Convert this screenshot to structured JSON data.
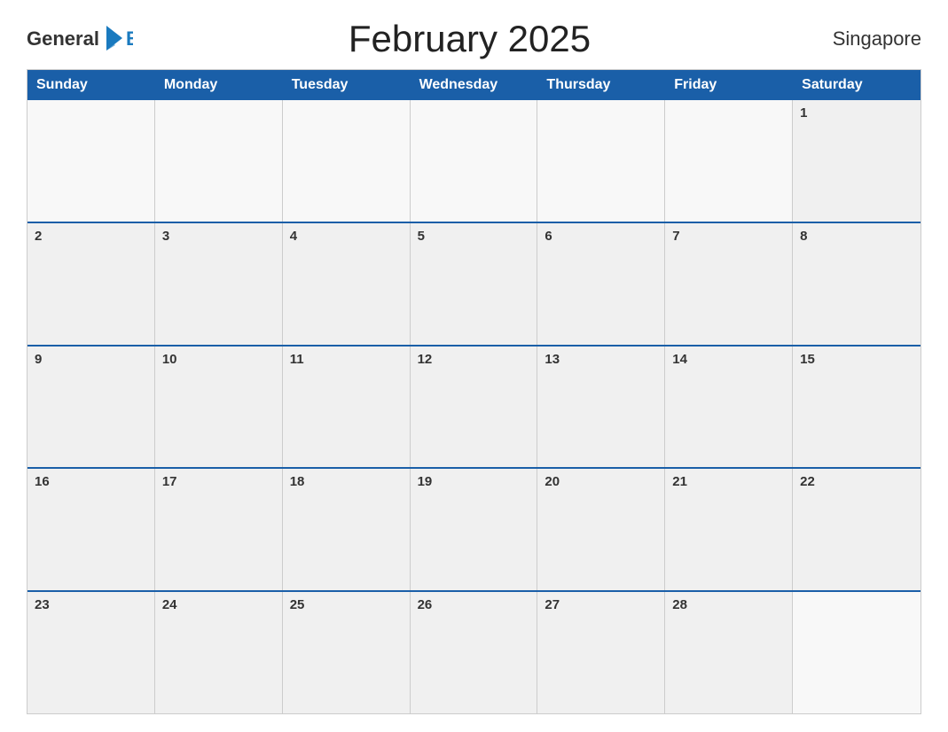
{
  "header": {
    "logo": {
      "text1": "General",
      "text2": "Blue"
    },
    "title": "February 2025",
    "region": "Singapore"
  },
  "days_of_week": [
    "Sunday",
    "Monday",
    "Tuesday",
    "Wednesday",
    "Thursday",
    "Friday",
    "Saturday"
  ],
  "weeks": [
    [
      {
        "day": "",
        "empty": true
      },
      {
        "day": "",
        "empty": true
      },
      {
        "day": "",
        "empty": true
      },
      {
        "day": "",
        "empty": true
      },
      {
        "day": "",
        "empty": true
      },
      {
        "day": "",
        "empty": true
      },
      {
        "day": "1",
        "empty": false
      }
    ],
    [
      {
        "day": "2",
        "empty": false
      },
      {
        "day": "3",
        "empty": false
      },
      {
        "day": "4",
        "empty": false
      },
      {
        "day": "5",
        "empty": false
      },
      {
        "day": "6",
        "empty": false
      },
      {
        "day": "7",
        "empty": false
      },
      {
        "day": "8",
        "empty": false
      }
    ],
    [
      {
        "day": "9",
        "empty": false
      },
      {
        "day": "10",
        "empty": false
      },
      {
        "day": "11",
        "empty": false
      },
      {
        "day": "12",
        "empty": false
      },
      {
        "day": "13",
        "empty": false
      },
      {
        "day": "14",
        "empty": false
      },
      {
        "day": "15",
        "empty": false
      }
    ],
    [
      {
        "day": "16",
        "empty": false
      },
      {
        "day": "17",
        "empty": false
      },
      {
        "day": "18",
        "empty": false
      },
      {
        "day": "19",
        "empty": false
      },
      {
        "day": "20",
        "empty": false
      },
      {
        "day": "21",
        "empty": false
      },
      {
        "day": "22",
        "empty": false
      }
    ],
    [
      {
        "day": "23",
        "empty": false
      },
      {
        "day": "24",
        "empty": false
      },
      {
        "day": "25",
        "empty": false
      },
      {
        "day": "26",
        "empty": false
      },
      {
        "day": "27",
        "empty": false
      },
      {
        "day": "28",
        "empty": false
      },
      {
        "day": "",
        "empty": true
      }
    ]
  ]
}
